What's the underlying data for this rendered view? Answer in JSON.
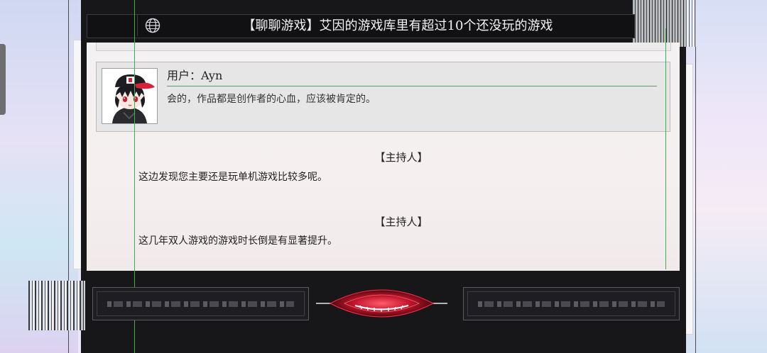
{
  "title_bar": {
    "title": "【聊聊游戏】艾因的游戏库里有超过10个还没玩的游戏",
    "icon": "globe-icon"
  },
  "user_card": {
    "name": "用户：Ayn",
    "message": "会的，作品都是创作者的心血，应该被肯定的。",
    "avatar_icon": "chibi-avatar-red-cap"
  },
  "messages": [
    {
      "speaker": "【主持人】",
      "text": "这边发现您主要还是玩单机游戏比较多呢。"
    },
    {
      "speaker": "【主持人】",
      "text": "这几年双人游戏的游戏时长倒是有显著提升。"
    }
  ],
  "controls": {
    "left_button_icon": "glitched-button",
    "right_button_icon": "glitched-button",
    "center_icon": "red-eye-logo"
  },
  "colors": {
    "frame": "#17171a",
    "accent_green": "#3db04a",
    "accent_red": "#d8213a"
  }
}
